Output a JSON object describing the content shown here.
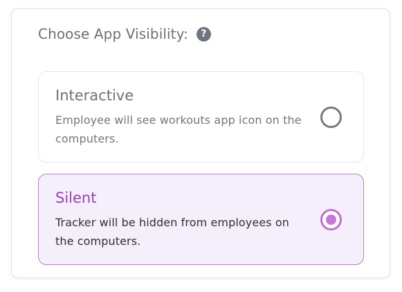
{
  "visibility": {
    "title": "Choose App Visibility:",
    "help_icon": "question-circle-icon",
    "help_symbol": "?",
    "options": [
      {
        "title": "Interactive",
        "description": "Employee will see workouts app icon on the computers.",
        "selected": false
      },
      {
        "title": "Silent",
        "description": "Tracker will be hidden from employees on the computers.",
        "selected": true
      }
    ]
  },
  "colors": {
    "accent": "#9a3fb0",
    "selected_border": "#b97fc1",
    "selected_background": "#f5effb",
    "radio_selected": "#c378d8",
    "muted_text": "#6f7079"
  }
}
